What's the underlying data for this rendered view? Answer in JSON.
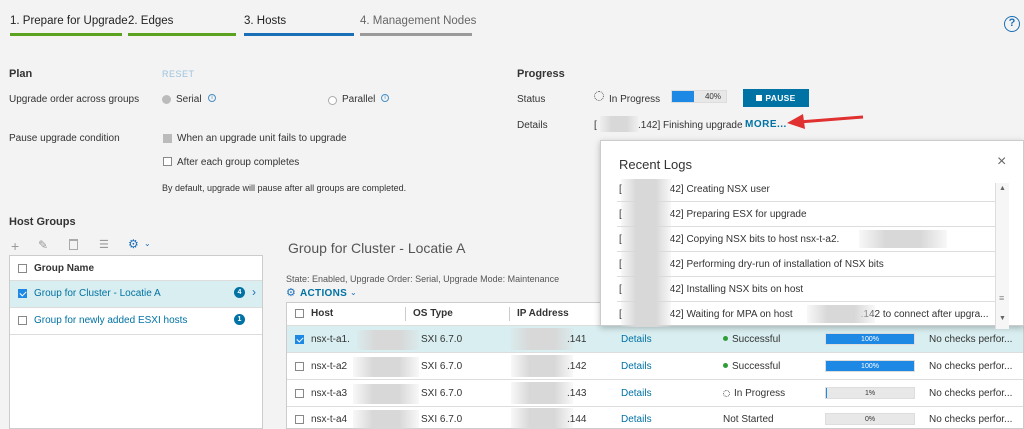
{
  "steps": [
    {
      "label": "1. Prepare for Upgrade",
      "color": "#5aa220"
    },
    {
      "label": "2. Edges",
      "color": "#5aa220"
    },
    {
      "label": "3. Hosts",
      "color": "#1b6fb7"
    },
    {
      "label": "4. Management Nodes",
      "color": "#9a9a9a"
    }
  ],
  "help": "?",
  "plan": {
    "title": "Plan",
    "reset": "RESET",
    "upgrade_order_label": "Upgrade order across groups",
    "serial": "Serial",
    "parallel": "Parallel",
    "pause_condition_label": "Pause upgrade condition",
    "pause_option1": "When an upgrade unit fails to upgrade",
    "pause_option2": "After each group completes",
    "note": "By default, upgrade will pause after all groups are completed."
  },
  "progress": {
    "title": "Progress",
    "status_label": "Status",
    "status_value": "In Progress",
    "percent_text": "40%",
    "percent": 40,
    "pause_button": "PAUSE",
    "details_label": "Details",
    "details_prefix": "[",
    "details_value": ".142] Finishing upgrade",
    "more_link": "MORE..."
  },
  "host_groups": {
    "title": "Host Groups",
    "column": "Group Name",
    "groups": [
      {
        "name": "Group for Cluster - Locatie A",
        "count": "4"
      },
      {
        "name": "Group for newly added ESXI hosts",
        "count": "1"
      }
    ]
  },
  "group_detail": {
    "title": "Group for Cluster - Locatie A",
    "meta": "State: Enabled, Upgrade Order: Serial, Upgrade Mode: Maintenance",
    "actions": "ACTIONS"
  },
  "table": {
    "columns": [
      "Host",
      "OS Type",
      "IP Address"
    ],
    "rows": [
      {
        "host": "nsx-t-a1.",
        "os": "SXI 6.7.0",
        "ip": ".141",
        "details": "Details",
        "status": "Successful",
        "pct": 100,
        "pct_text": "100%",
        "checks": "No checks perfor..."
      },
      {
        "host": "nsx-t-a2",
        "os": "SXI 6.7.0",
        "ip": ".142",
        "details": "Details",
        "status": "Successful",
        "pct": 100,
        "pct_text": "100%",
        "checks": "No checks perfor..."
      },
      {
        "host": "nsx-t-a3",
        "os": "SXI 6.7.0",
        "ip": ".143",
        "details": "Details",
        "status": "In Progress",
        "pct": 1,
        "pct_text": "1%",
        "checks": "No checks perfor..."
      },
      {
        "host": "nsx-t-a4",
        "os": "SXI 6.7.0",
        "ip": ".144",
        "details": "Details",
        "status": "Not Started",
        "pct": 0,
        "pct_text": "0%",
        "checks": "No checks perfor..."
      }
    ]
  },
  "logs": {
    "title": "Recent Logs",
    "close": "×",
    "entries": [
      {
        "prefix": "[",
        "text": "42] Creating NSX user"
      },
      {
        "prefix": "[",
        "text": "42] Preparing ESX for upgrade"
      },
      {
        "prefix": "[",
        "text": "42] Copying NSX bits to host nsx-t-a2."
      },
      {
        "prefix": "[",
        "text": "42] Performing dry-run of installation of NSX bits"
      },
      {
        "prefix": "[",
        "text": "42] Installing NSX bits on host"
      },
      {
        "prefix": "[",
        "text": "42] Waiting for MPA on host",
        "suffix": ".142 to connect after upgra..."
      }
    ]
  },
  "colors": {
    "accent": "#0072a3",
    "arrow": "#e03030",
    "success": "#2e9d3a",
    "selected_row": "#d9eef0"
  }
}
